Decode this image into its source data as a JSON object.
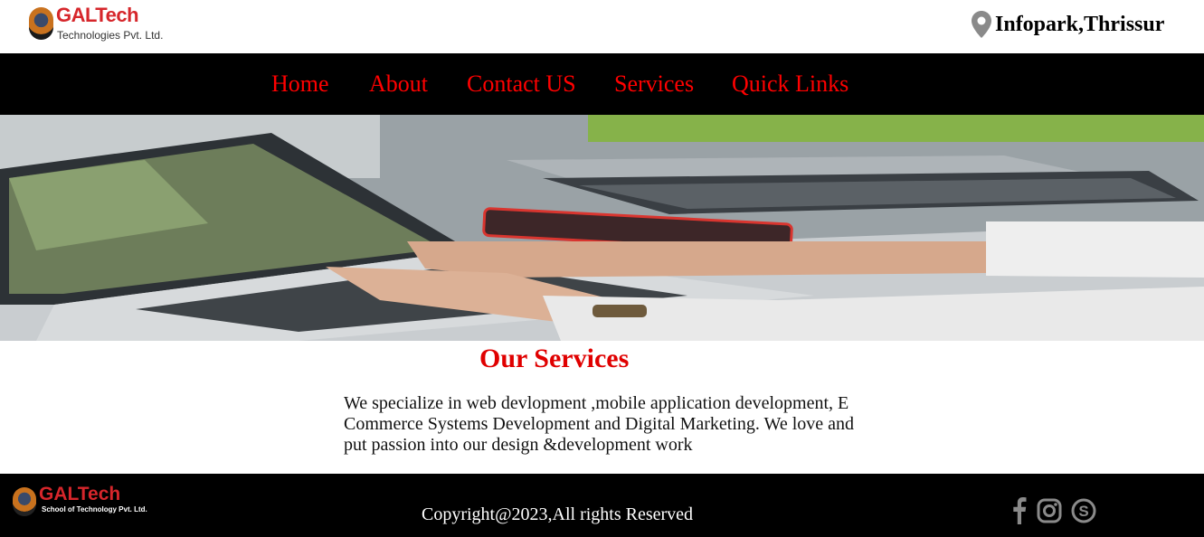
{
  "header": {
    "logo_name": "GALTech",
    "logo_subtitle": "Technologies Pvt. Ltd.",
    "location": "Infopark,Thrissur"
  },
  "nav": {
    "items": [
      {
        "label": "Home"
      },
      {
        "label": "About"
      },
      {
        "label": "Contact US"
      },
      {
        "label": "Services"
      },
      {
        "label": "Quick Links"
      }
    ]
  },
  "services": {
    "title": "Our Services",
    "description": "We specialize in web devlopment ,mobile application development, E Commerce Systems Development and Digital Marketing. We love and put passion into our design &development work"
  },
  "footer": {
    "logo_name": "GALTech",
    "logo_subtitle": "School of Technology Pvt. Ltd.",
    "copyright": "Copyright@2023,All rights Reserved",
    "social": [
      "facebook-icon",
      "instagram-icon",
      "skype-icon"
    ]
  },
  "colors": {
    "nav_bg": "#000000",
    "nav_link": "#ff0000",
    "title": "#e00000",
    "brand_red": "#d6262b",
    "icon_gray": "#8a8a8a"
  }
}
